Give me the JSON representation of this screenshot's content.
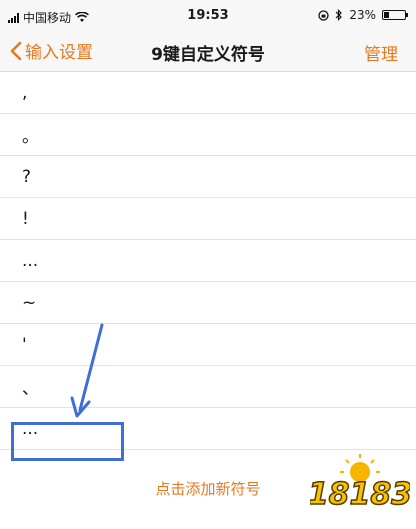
{
  "status_bar": {
    "carrier": "中国移动",
    "time": "19:53",
    "battery_percent": "23%",
    "battery_level": 0.23
  },
  "nav": {
    "back_label": "输入设置",
    "title": "9键自定义符号",
    "manage_label": "管理"
  },
  "symbols": [
    ",",
    "。",
    "?",
    "!",
    "...",
    "~",
    "'",
    "、",
    "..."
  ],
  "add_label": "点击添加新符号",
  "watermark": "18183",
  "colors": {
    "accent": "#e8781e",
    "highlight": "#3d6fd6"
  }
}
